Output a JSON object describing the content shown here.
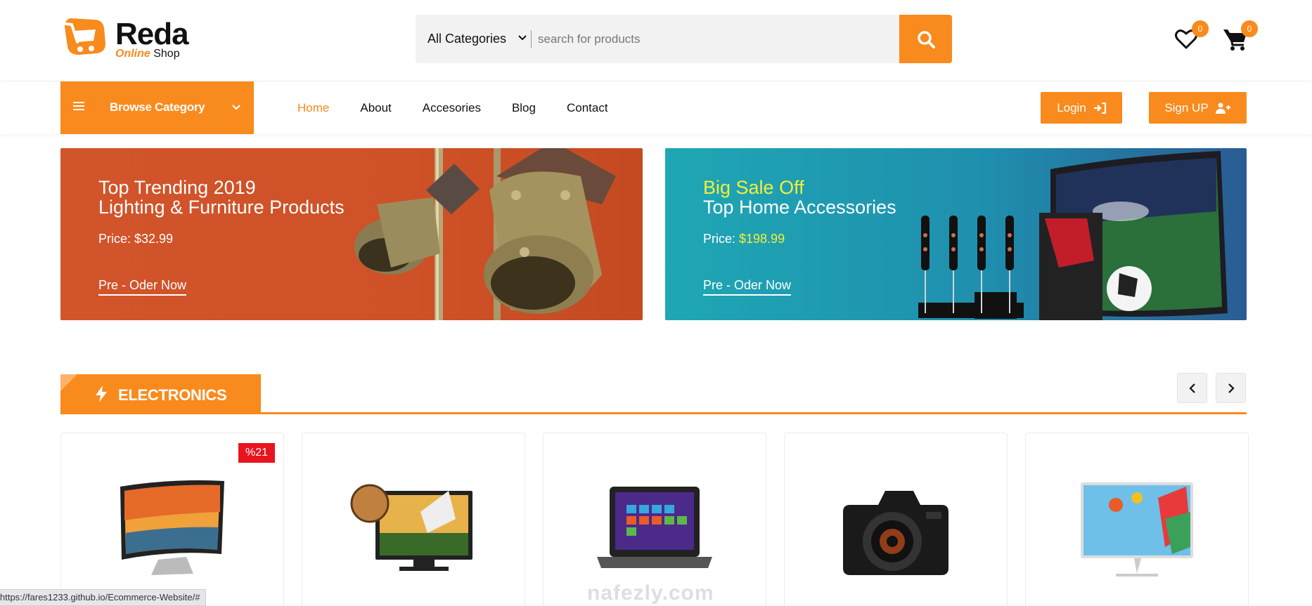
{
  "brand": {
    "name": "Reda",
    "sub_accent": "Online",
    "sub_rest": " Shop"
  },
  "search": {
    "category": "All Categories",
    "placeholder": "search for products"
  },
  "header": {
    "wishlist_count": "0",
    "cart_count": "0"
  },
  "nav": {
    "browse_label": "Browse Category",
    "links": [
      {
        "label": "Home",
        "active": true
      },
      {
        "label": "About"
      },
      {
        "label": "Accesories"
      },
      {
        "label": "Blog"
      },
      {
        "label": "Contact"
      }
    ],
    "login_label": "Login",
    "signup_label": "Sign UP"
  },
  "banners": [
    {
      "title_line1": "Top Trending 2019",
      "title_line2": "Lighting & Furniture Products",
      "price_label": "Price: $32.99",
      "cta": "Pre - Oder Now"
    },
    {
      "title_line1": "Big Sale Off",
      "title_line2": "Top Home Accessories",
      "price_prefix": "Price: ",
      "price_value": "$198.99",
      "cta": "Pre - Oder Now"
    }
  ],
  "section": {
    "title": "ELECTRONICS"
  },
  "products": [
    {
      "badge": "%21",
      "icon": "curved-tv-icon"
    },
    {
      "icon": "tv-football-icon"
    },
    {
      "icon": "laptop-icon"
    },
    {
      "icon": "camera-icon"
    },
    {
      "icon": "monitor-icon"
    }
  ],
  "status_bar": {
    "url": "https://fares1233.github.io/Ecommerce-Website/#"
  },
  "watermark": "nafezly.com",
  "colors": {
    "accent": "#f98a1d",
    "discount": "#e8141e",
    "highlight": "#f4ee3a"
  }
}
